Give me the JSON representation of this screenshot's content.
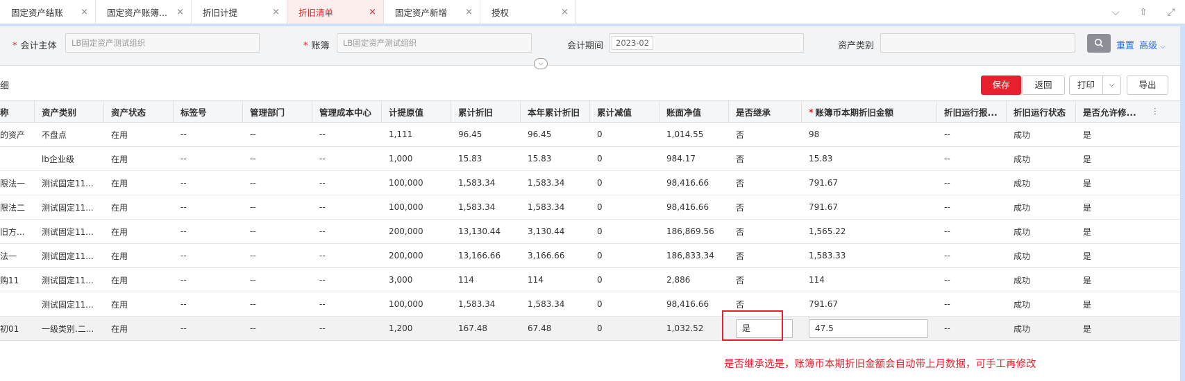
{
  "tabs": [
    {
      "label": "固定资产结账",
      "active": false
    },
    {
      "label": "固定资产账簿...",
      "active": false
    },
    {
      "label": "折旧计提",
      "active": false
    },
    {
      "label": "折旧清单",
      "active": true
    },
    {
      "label": "固定资产新增",
      "active": false
    },
    {
      "label": "授权",
      "active": false
    }
  ],
  "tab_close": "×",
  "tab_tools": {
    "dropdown": "⌵",
    "upload": "⇧",
    "expand": "⤢"
  },
  "filters": {
    "entity_label": "会计主体",
    "entity_value": "LB固定资产测试组织",
    "book_label": "账簿",
    "book_value": "LB固定资产测试组织",
    "period_label": "会计期间",
    "period_value": "2023-02",
    "category_label": "资产类别",
    "category_value": "",
    "required_mark": "*",
    "reset": "重置",
    "advanced": "高级",
    "advanced_caret": "⌵",
    "collapse_caret": "⌵"
  },
  "section_title": "细",
  "actions": {
    "save": "保存",
    "back": "返回",
    "print": "打印",
    "print_caret": "⌵",
    "export": "导出"
  },
  "table": {
    "columns": [
      "称",
      "资产类别",
      "资产状态",
      "标签号",
      "管理部门",
      "管理成本中心",
      "计提原值",
      "累计折旧",
      "本年累计折旧",
      "累计减值",
      "账面净值",
      "是否继承",
      "账簿币本期折旧金额",
      "折旧运行报...",
      "折旧运行状态",
      "是否允许修..."
    ],
    "required_col_mark": "*",
    "settings_icon": "⫶",
    "rows": [
      [
        "的资产",
        "不盘点",
        "在用",
        "--",
        "--",
        "--",
        "1,111",
        "96.45",
        "96.45",
        "0",
        "1,014.55",
        "否",
        "98",
        "--",
        "成功",
        "是"
      ],
      [
        "",
        "lb企业级",
        "在用",
        "--",
        "--",
        "--",
        "1,000",
        "15.83",
        "15.83",
        "0",
        "984.17",
        "否",
        "15.83",
        "--",
        "成功",
        "是"
      ],
      [
        "限法一",
        "测试固定11...",
        "在用",
        "--",
        "--",
        "--",
        "100,000",
        "1,583.34",
        "1,583.34",
        "0",
        "98,416.66",
        "否",
        "791.67",
        "--",
        "成功",
        "是"
      ],
      [
        "限法二",
        "测试固定11...",
        "在用",
        "--",
        "--",
        "--",
        "100,000",
        "1,583.34",
        "1,583.34",
        "0",
        "98,416.66",
        "否",
        "791.67",
        "--",
        "成功",
        "是"
      ],
      [
        "旧方...",
        "测试固定11...",
        "在用",
        "--",
        "--",
        "--",
        "200,000",
        "13,130.44",
        "3,130.44",
        "0",
        "186,869.56",
        "否",
        "1,565.22",
        "--",
        "成功",
        "是"
      ],
      [
        "法一",
        "测试固定11...",
        "在用",
        "--",
        "--",
        "--",
        "200,000",
        "13,166.66",
        "3,166.66",
        "0",
        "186,833.34",
        "否",
        "1,583.33",
        "--",
        "成功",
        "是"
      ],
      [
        "购11",
        "测试固定11...",
        "在用",
        "--",
        "--",
        "--",
        "3,000",
        "114",
        "114",
        "0",
        "2,886",
        "否",
        "114",
        "--",
        "成功",
        "是"
      ],
      [
        "",
        "测试固定11...",
        "在用",
        "--",
        "--",
        "--",
        "100,000",
        "1,583.34",
        "1,583.34",
        "0",
        "98,416.66",
        "否",
        "791.67",
        "--",
        "成功",
        "是"
      ],
      [
        "初01",
        "一级类别.二...",
        "在用",
        "--",
        "--",
        "--",
        "1,200",
        "167.48",
        "67.48",
        "0",
        "1,032.52",
        "是",
        "47.5",
        "--",
        "成功",
        "是"
      ]
    ]
  },
  "annotation": "是否继承选是，账簿币本期折旧金额会自动带上月数据，可手工再修改"
}
